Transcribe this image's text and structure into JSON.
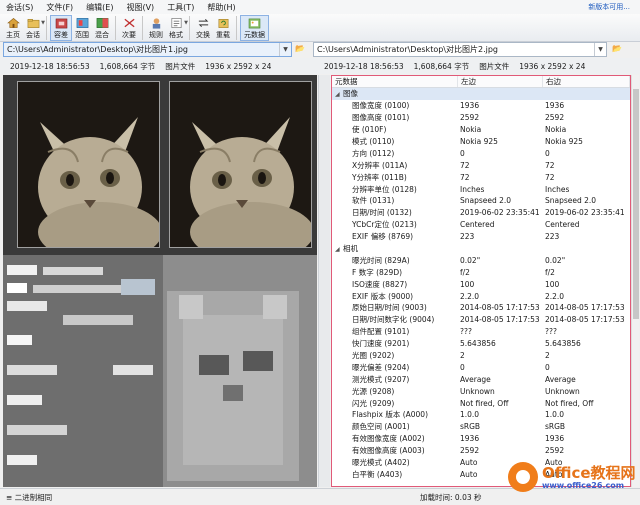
{
  "menu": {
    "items": [
      "会话(S)",
      "文件(F)",
      "编辑(E)",
      "视图(V)",
      "工具(T)",
      "帮助(H)"
    ],
    "update_link": "新版本可用..."
  },
  "toolbar": {
    "buttons": [
      {
        "label": "主页",
        "icon": "home-icon"
      },
      {
        "label": "会话",
        "icon": "session-folder-icon"
      },
      {
        "label": "容差",
        "icon": "tolerance-icon"
      },
      {
        "label": "范围",
        "icon": "range-icon"
      },
      {
        "label": "混合",
        "icon": "blend-icon"
      },
      {
        "label": "次要",
        "icon": "minor-icon"
      },
      {
        "label": "规则",
        "icon": "rules-icon"
      },
      {
        "label": "格式",
        "icon": "format-icon"
      },
      {
        "label": "交换",
        "icon": "swap-icon"
      },
      {
        "label": "重载",
        "icon": "reload-icon"
      },
      {
        "label": "元数据",
        "icon": "metadata-icon"
      }
    ]
  },
  "left": {
    "path": "C:\\Users\\Administrator\\Desktop\\对比图片1.jpg",
    "info": [
      "2019-12-18 18:56:53",
      "1,608,664 字节",
      "图片文件",
      "1936 x 2592 x 24"
    ]
  },
  "right": {
    "path": "C:\\Users\\Administrator\\Desktop\\对比图片2.jpg",
    "info": [
      "2019-12-18 18:56:53",
      "1,608,664 字节",
      "图片文件",
      "1936 x 2592 x 24"
    ]
  },
  "meta": {
    "columns": [
      "元数据",
      "左边",
      "右边"
    ],
    "rows": [
      {
        "g": true,
        "k": "图像"
      },
      {
        "k": "图像宽度 (0100)",
        "l": "1936",
        "r": "1936"
      },
      {
        "k": "图像高度 (0101)",
        "l": "2592",
        "r": "2592"
      },
      {
        "k": "使 (010F)",
        "l": "Nokia",
        "r": "Nokia"
      },
      {
        "k": "模式 (0110)",
        "l": "Nokia 925",
        "r": "Nokia 925"
      },
      {
        "k": "方向 (0112)",
        "l": "0",
        "r": "0"
      },
      {
        "k": "X分辨率 (011A)",
        "l": "72",
        "r": "72"
      },
      {
        "k": "Y分辨率 (011B)",
        "l": "72",
        "r": "72"
      },
      {
        "k": "分辨率单位 (0128)",
        "l": "Inches",
        "r": "Inches"
      },
      {
        "k": "软件 (0131)",
        "l": "Snapseed 2.0",
        "r": "Snapseed 2.0"
      },
      {
        "k": "日期/时间 (0132)",
        "l": "2019-06-02 23:35:41",
        "r": "2019-06-02 23:35:41"
      },
      {
        "k": "YCbCr定位 (0213)",
        "l": "Centered",
        "r": "Centered"
      },
      {
        "k": "EXIF 偏移 (8769)",
        "l": "223",
        "r": "223"
      },
      {
        "g": true,
        "plain": true,
        "k": "相机"
      },
      {
        "k": "曝光时间 (829A)",
        "l": "0.02\"",
        "r": "0.02\""
      },
      {
        "k": "F 数字 (829D)",
        "l": "f/2",
        "r": "f/2"
      },
      {
        "k": "ISO速度 (8827)",
        "l": "100",
        "r": "100"
      },
      {
        "k": "EXIF 版本 (9000)",
        "l": "2.2.0",
        "r": "2.2.0"
      },
      {
        "k": "原始日期/时间 (9003)",
        "l": "2014-08-05 17:17:53",
        "r": "2014-08-05 17:17:53"
      },
      {
        "k": "日期/时间数字化 (9004)",
        "l": "2014-08-05 17:17:53",
        "r": "2014-08-05 17:17:53"
      },
      {
        "k": "组件配置 (9101)",
        "l": "???",
        "r": "???"
      },
      {
        "k": "快门速度 (9201)",
        "l": "5.643856",
        "r": "5.643856"
      },
      {
        "k": "光圈 (9202)",
        "l": "2",
        "r": "2"
      },
      {
        "k": "曝光偏差 (9204)",
        "l": "0",
        "r": "0"
      },
      {
        "k": "测光模式 (9207)",
        "l": "Average",
        "r": "Average"
      },
      {
        "k": "光源 (9208)",
        "l": "Unknown",
        "r": "Unknown"
      },
      {
        "k": "闪光 (9209)",
        "l": "Not fired, Off",
        "r": "Not fired, Off"
      },
      {
        "k": "Flashpix 版本 (A000)",
        "l": "1.0.0",
        "r": "1.0.0"
      },
      {
        "k": "颜色空间 (A001)",
        "l": "sRGB",
        "r": "sRGB"
      },
      {
        "k": "有效图像宽度 (A002)",
        "l": "1936",
        "r": "1936"
      },
      {
        "k": "有效图像高度 (A003)",
        "l": "2592",
        "r": "2592"
      },
      {
        "k": "曝光模式 (A402)",
        "l": "Auto",
        "r": "Auto"
      },
      {
        "k": "白平衡 (A403)",
        "l": "Auto",
        "r": "Auto"
      }
    ]
  },
  "status": {
    "left": "二进制相同",
    "right": "加载时间: 0.03 秒"
  },
  "watermark": {
    "line1": "Office教程网",
    "line2": "www.office26.com"
  }
}
